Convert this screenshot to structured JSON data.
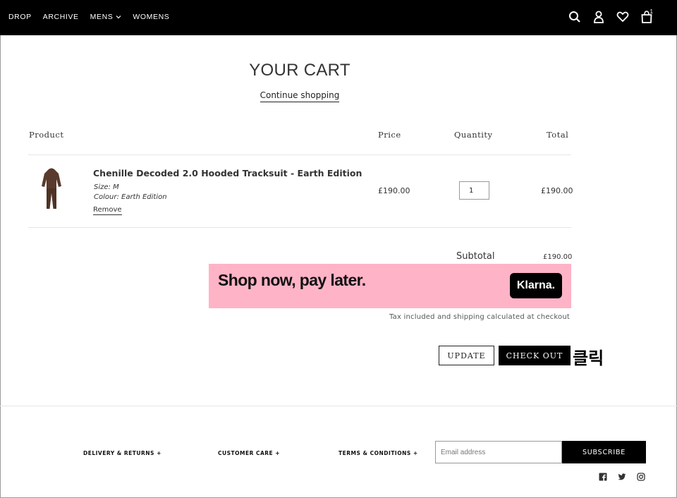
{
  "nav": {
    "items": [
      {
        "label": "DROP"
      },
      {
        "label": "ARCHIVE"
      },
      {
        "label": "MENS",
        "has_dropdown": true
      },
      {
        "label": "WOMENS"
      }
    ],
    "icons": [
      "search-icon",
      "account-icon",
      "wishlist-icon",
      "cart-icon"
    ],
    "cart_count": "1"
  },
  "cart": {
    "title": "YOUR CART",
    "continue_label": "Continue shopping",
    "headers": {
      "product": "Product",
      "price": "Price",
      "quantity": "Quantity",
      "total": "Total"
    },
    "items": [
      {
        "name": "Chenille Decoded 2.0 Hooded Tracksuit - Earth Edition",
        "size": "Size: M",
        "colour": "Colour: Earth Edition",
        "remove_label": "Remove",
        "price": "£190.00",
        "quantity": "1",
        "total": "£190.00",
        "thumb_color": "#5a3a2c"
      }
    ],
    "subtotal_label": "Subtotal",
    "subtotal_value": "£190.00",
    "klarna": {
      "text": "Shop now, pay later.",
      "logo": "Klarna.",
      "bg": "#ffb3c7"
    },
    "tax_note": "Tax included and shipping calculated at checkout",
    "update_label": "UPDATE",
    "checkout_label": "CHECK OUT",
    "annotation": "클릭"
  },
  "footer": {
    "links": [
      "DELIVERY & RETURNS +",
      "CUSTOMER CARE +",
      "TERMS & CONDITIONS +"
    ],
    "email_placeholder": "Email address",
    "subscribe_label": "SUBSCRIBE",
    "social": [
      "facebook-icon",
      "twitter-icon",
      "instagram-icon"
    ]
  }
}
